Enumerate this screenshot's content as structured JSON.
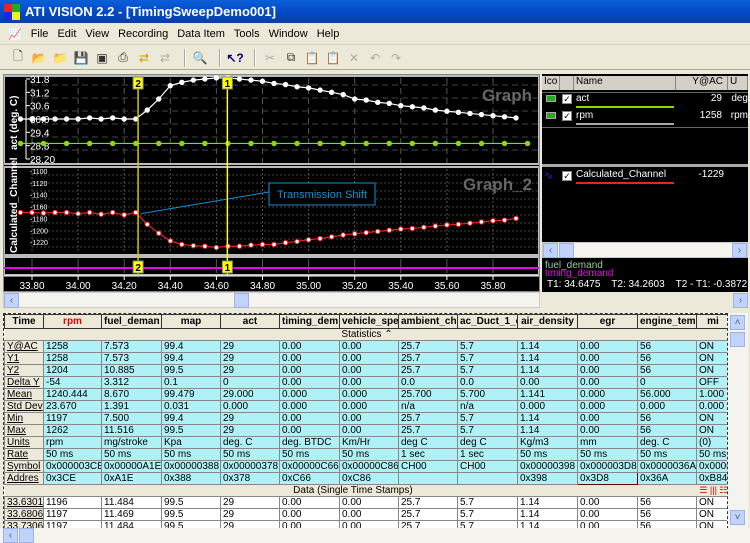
{
  "window": {
    "title": "ATI VISION 2.2 - [TimingSweepDemo001]"
  },
  "menu": [
    "File",
    "Edit",
    "View",
    "Recording",
    "Data Item",
    "Tools",
    "Window",
    "Help"
  ],
  "toolbar": [
    "new-icon",
    "open-icon",
    "open-folder-icon",
    "save-icon",
    "save-all-icon",
    "print-icon",
    "export-icon",
    "import-icon",
    "find-icon",
    "help-pointer-icon",
    "cut-icon",
    "copy-icon",
    "paste-icon",
    "paste-special-icon",
    "delete-icon",
    "undo-icon",
    "redo-icon"
  ],
  "graph": {
    "graph1": {
      "title": "Graph",
      "ylabel": "act (deg. C)",
      "yticks": [
        "31.8",
        "31.2",
        "30.6",
        "30.0",
        "29.4",
        "28.8",
        "28.20"
      ],
      "ylim": [
        28.2,
        31.8
      ]
    },
    "graph2": {
      "title": "Graph_2",
      "ylabel": "Calculated_Channel",
      "yticks": [
        "-1100",
        "-1120",
        "-1140",
        "-1160",
        "-1180",
        "-1200",
        "-1220"
      ],
      "ylim": [
        -1235,
        -1100
      ]
    },
    "xticks": [
      "33.80",
      "34.00",
      "34.20",
      "34.40",
      "34.60",
      "34.80",
      "35.00",
      "35.20",
      "35.40",
      "35.60",
      "35.80"
    ],
    "xlim": [
      33.75,
      35.97
    ],
    "annotation": "Transmission Shift",
    "cursor1": {
      "label": "1",
      "t": 34.6475
    },
    "cursor2": {
      "label": "2",
      "t": 34.2603
    },
    "series": [
      {
        "name": "rpm",
        "color": "#ffffff",
        "panel": 1,
        "x": [
          33.75,
          33.8,
          33.85,
          33.9,
          33.95,
          34.0,
          34.05,
          34.1,
          34.15,
          34.2,
          34.25,
          34.3,
          34.35,
          34.4,
          34.45,
          34.5,
          34.55,
          34.6,
          34.65,
          34.7,
          34.75,
          34.8,
          34.85,
          34.9,
          34.95,
          35.0,
          35.05,
          35.1,
          35.15,
          35.2,
          35.25,
          35.3,
          35.35,
          35.4,
          35.45,
          35.5,
          35.55,
          35.6,
          35.65,
          35.7,
          35.75,
          35.8,
          35.85,
          35.9
        ],
        "y": [
          30.0,
          30.0,
          30.0,
          30.0,
          30.0,
          30.0,
          30.05,
          30.0,
          30.05,
          30.0,
          30.0,
          30.4,
          30.9,
          31.5,
          31.65,
          31.75,
          31.8,
          31.85,
          31.85,
          31.8,
          31.75,
          31.7,
          31.6,
          31.55,
          31.45,
          31.4,
          31.3,
          31.2,
          31.1,
          30.9,
          30.85,
          30.75,
          30.7,
          30.6,
          30.55,
          30.5,
          30.4,
          30.35,
          30.3,
          30.25,
          30.2,
          30.15,
          30.1,
          30.05
        ]
      },
      {
        "name": "act",
        "color": "#88dd00",
        "panel": 1,
        "x": [
          33.75,
          33.85,
          33.95,
          34.05,
          34.15,
          34.25,
          34.35,
          34.45,
          34.55,
          34.65,
          34.75,
          34.85,
          34.95,
          35.05,
          35.15,
          35.25,
          35.35,
          35.45,
          35.55,
          35.65,
          35.75,
          35.85,
          35.95
        ],
        "y": [
          28.9,
          28.9,
          28.9,
          28.9,
          28.9,
          28.9,
          28.9,
          28.9,
          28.9,
          28.9,
          28.9,
          28.9,
          28.9,
          28.9,
          28.9,
          28.9,
          28.9,
          28.9,
          28.9,
          28.9,
          28.9,
          28.9,
          28.9
        ]
      },
      {
        "name": "Calculated_Channel",
        "color": "#ee2020",
        "panel": 2,
        "x": [
          33.75,
          33.8,
          33.85,
          33.9,
          33.95,
          34.0,
          34.05,
          34.1,
          34.15,
          34.2,
          34.25,
          34.3,
          34.35,
          34.4,
          34.45,
          34.5,
          34.55,
          34.6,
          34.65,
          34.7,
          34.75,
          34.8,
          34.85,
          34.9,
          34.95,
          35.0,
          35.05,
          35.1,
          35.15,
          35.2,
          35.25,
          35.3,
          35.35,
          35.4,
          35.45,
          35.5,
          35.55,
          35.6,
          35.65,
          35.7,
          35.75,
          35.8,
          35.85,
          35.9
        ],
        "y": [
          -1170,
          -1170,
          -1171,
          -1170,
          -1170,
          -1172,
          -1170,
          -1173,
          -1170,
          -1174,
          -1170,
          -1190,
          -1205,
          -1218,
          -1224,
          -1226,
          -1227,
          -1229,
          -1227,
          -1227,
          -1225,
          -1224,
          -1224,
          -1221,
          -1219,
          -1216,
          -1214,
          -1211,
          -1208,
          -1206,
          -1204,
          -1202,
          -1200,
          -1198,
          -1197,
          -1195,
          -1193,
          -1191,
          -1190,
          -1188,
          -1186,
          -1184,
          -1183,
          -1180
        ]
      }
    ]
  },
  "legend": {
    "headers": [
      "Ico",
      "",
      "Name",
      "Y@AC",
      "U"
    ],
    "rows": [
      {
        "name": "act",
        "value": "29",
        "unit": "deg",
        "color": "#88dd00"
      },
      {
        "name": "rpm",
        "value": "1258",
        "unit": "rpm",
        "color": "#aaaaaa"
      }
    ],
    "rows2": [
      {
        "name": "Calculated_Channel",
        "value": "-1229",
        "color": "#ee2020"
      }
    ],
    "strip": {
      "line1": "fuel_demand",
      "line2": "timing_demand",
      "cursors": "T1: 34.6475    T2: 34.2603    T2 - T1: -0.3872"
    }
  },
  "table": {
    "columns": [
      "Time",
      "rpm",
      "fuel_deman",
      "map",
      "act",
      "timing_dem",
      "vehicle_spe",
      "ambient_ch",
      "ac_Duct_1_c",
      "air_density",
      "egr",
      "engine_tem",
      "mi"
    ],
    "stats_band": "Statistics",
    "stats": [
      [
        "Y@AC",
        "1258",
        "7.573",
        "99.4",
        "29",
        "0.00",
        "0.00",
        "25.7",
        "5.7",
        "1.14",
        "0.00",
        "56",
        "ON"
      ],
      [
        "Y1",
        "1258",
        "7.573",
        "99.4",
        "29",
        "0.00",
        "0.00",
        "25.7",
        "5.7",
        "1.14",
        "0.00",
        "56",
        "ON"
      ],
      [
        "Y2",
        "1204",
        "10.885",
        "99.5",
        "29",
        "0.00",
        "0.00",
        "25.7",
        "5.7",
        "1.14",
        "0.00",
        "56",
        "ON"
      ],
      [
        "Delta Y",
        "-54",
        "3.312",
        "0.1",
        "0",
        "0.00",
        "0.00",
        "0.0",
        "0.0",
        "0.00",
        "0.00",
        "0",
        "OFF"
      ],
      [
        "Mean",
        "1240.444",
        "8.670",
        "99.479",
        "29.000",
        "0.000",
        "0.000",
        "25.700",
        "5.700",
        "1.141",
        "0.000",
        "56.000",
        "1.000"
      ],
      [
        "Std Dev",
        "23.670",
        "1.391",
        "0.031",
        "0.000",
        "0.000",
        "0.000",
        "n/a",
        "n/a",
        "0.000",
        "0.000",
        "0.000",
        "0.000"
      ],
      [
        "Min",
        "1197",
        "7.500",
        "99.4",
        "29",
        "0.00",
        "0.00",
        "25.7",
        "5.7",
        "1.14",
        "0.00",
        "56",
        "ON"
      ],
      [
        "Max",
        "1262",
        "11.516",
        "99.5",
        "29",
        "0.00",
        "0.00",
        "25.7",
        "5.7",
        "1.14",
        "0.00",
        "56",
        "ON"
      ],
      [
        "Units",
        "rpm",
        "mg/stroke",
        "Kpa",
        "deg. C",
        "deg. BTDC",
        "Km/Hr",
        "deg C",
        "deg C",
        "Kg/m3",
        "mm",
        "deg. C",
        "(0)"
      ],
      [
        "Rate",
        "50 ms",
        "50 ms",
        "50 ms",
        "50 ms",
        "50 ms",
        "50 ms",
        "1 sec",
        "1 sec",
        "50 ms",
        "50 ms",
        "50 ms",
        "50 ms"
      ],
      [
        "Symbol",
        "0x000003CE",
        "0x00000A1E",
        "0x00000388",
        "0x00000378",
        "0x00000C66",
        "0x00000C86",
        "CH00",
        "CH00",
        "0x00000398",
        "0x000003D8",
        "0x0000036A",
        "0x00000"
      ],
      [
        "Addres",
        "0x3CE",
        "0xA1E",
        "0x388",
        "0x378",
        "0xC66",
        "0xC86",
        "",
        "",
        "0x398",
        "0x3D8",
        "0x36A",
        "0xB84"
      ]
    ],
    "data_band": "Data (Single Time Stamps)",
    "rows": [
      [
        "33.6301",
        "1196",
        "11.484",
        "99.5",
        "29",
        "0.00",
        "0.00",
        "25.7",
        "5.7",
        "1.14",
        "0.00",
        "56",
        "ON"
      ],
      [
        "33.6806",
        "1197",
        "11.469",
        "99.5",
        "29",
        "0.00",
        "0.00",
        "25.7",
        "5.7",
        "1.14",
        "0.00",
        "56",
        "ON"
      ],
      [
        "33.7306",
        "1197",
        "11.484",
        "99.5",
        "29",
        "0.00",
        "0.00",
        "25.7",
        "5.7",
        "1.14",
        "0.00",
        "56",
        "ON"
      ]
    ]
  }
}
